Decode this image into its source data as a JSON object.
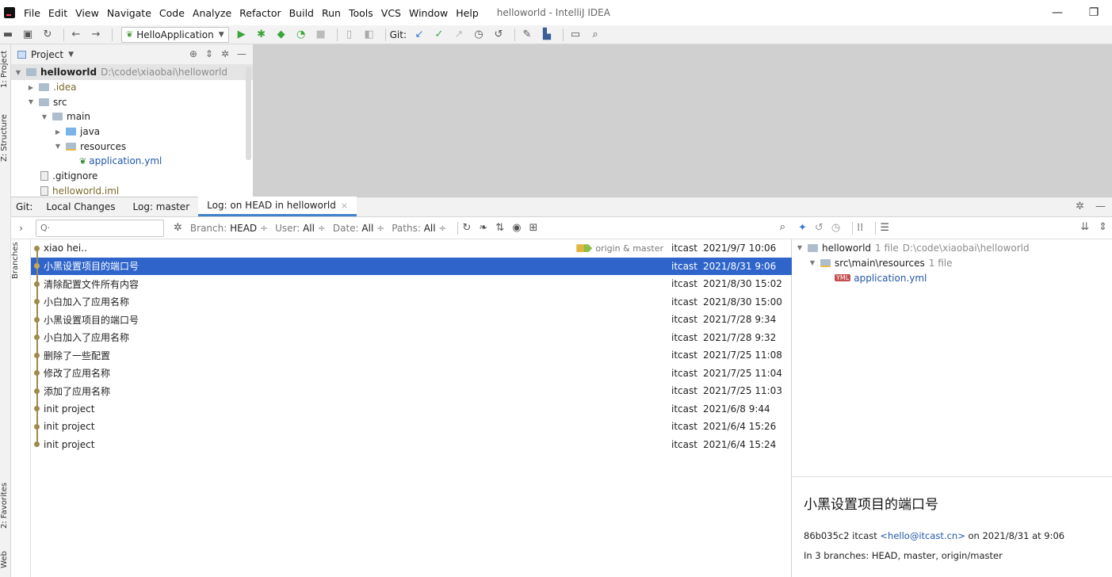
{
  "menubar": {
    "items": [
      "File",
      "Edit",
      "View",
      "Navigate",
      "Code",
      "Analyze",
      "Refactor",
      "Build",
      "Run",
      "Tools",
      "VCS",
      "Window",
      "Help"
    ],
    "window_title": "helloworld - IntelliJ IDEA",
    "minimize_glyph": "—",
    "restore_glyph": "❐"
  },
  "toolbar": {
    "run_config": "HelloApplication",
    "git_label": "Git:"
  },
  "left_strip": {
    "project_tab": "1: Project",
    "structure_tab": "Z: Structure",
    "favorites_tab": "2: Favorites",
    "web_tab": "Web"
  },
  "project_panel": {
    "title": "Project",
    "root_name": "helloworld",
    "root_path": "D:\\code\\xiaobai\\helloworld",
    "items": [
      ".idea",
      "src",
      "main",
      "java",
      "resources",
      "application.yml",
      ".gitignore",
      "helloworld.iml"
    ]
  },
  "git_tabs": {
    "prefix": "Git:",
    "tabs": [
      "Local Changes",
      "Log: master",
      "Log: on HEAD in helloworld"
    ],
    "close_glyph": "×"
  },
  "log_toolbar": {
    "search_placeholder": "Q·",
    "branch_label": "Branch:",
    "branch_value": "HEAD",
    "user_label": "User:",
    "user_value": "All",
    "date_label": "Date:",
    "date_value": "All",
    "paths_label": "Paths:",
    "paths_value": "All",
    "sort_glyph": "÷"
  },
  "branches_strip": "Branches",
  "commits": [
    {
      "message": "xiao hei..",
      "author": "itcast",
      "date": "2021/9/7 10:06",
      "ref": "origin & master"
    },
    {
      "message": "小黑设置项目的端口号",
      "author": "itcast",
      "date": "2021/8/31 9:06",
      "ref": ""
    },
    {
      "message": "清除配置文件所有内容",
      "author": "itcast",
      "date": "2021/8/30 15:02",
      "ref": ""
    },
    {
      "message": "小白加入了应用名称",
      "author": "itcast",
      "date": "2021/8/30 15:00",
      "ref": ""
    },
    {
      "message": "小黑设置项目的端口号",
      "author": "itcast",
      "date": "2021/7/28 9:34",
      "ref": ""
    },
    {
      "message": "小白加入了应用名称",
      "author": "itcast",
      "date": "2021/7/28 9:32",
      "ref": ""
    },
    {
      "message": "删除了一些配置",
      "author": "itcast",
      "date": "2021/7/25 11:08",
      "ref": ""
    },
    {
      "message": "修改了应用名称",
      "author": "itcast",
      "date": "2021/7/25 11:04",
      "ref": ""
    },
    {
      "message": "添加了应用名称",
      "author": "itcast",
      "date": "2021/7/25 11:03",
      "ref": ""
    },
    {
      "message": "init project",
      "author": "itcast",
      "date": "2021/6/8 9:44",
      "ref": ""
    },
    {
      "message": "init project",
      "author": "itcast",
      "date": "2021/6/4 15:26",
      "ref": ""
    },
    {
      "message": "init project",
      "author": "itcast",
      "date": "2021/6/4 15:24",
      "ref": ""
    }
  ],
  "selected_commit_index": 1,
  "changes": {
    "root": "helloworld",
    "root_count": "1 file",
    "root_path": "D:\\code\\xiaobai\\helloworld",
    "dir": "src\\main\\resources",
    "dir_count": "1 file",
    "file": "application.yml",
    "file_badge": "YML"
  },
  "commit_detail": {
    "title": "小黑设置项目的端口号",
    "hash_author": "86b035c2 itcast",
    "email": "<hello@itcast.cn>",
    "date_text": "on 2021/8/31 at 9:06",
    "branches": "In 3 branches: HEAD, master, origin/master"
  },
  "colors": {
    "selection": "#2f65ca",
    "graph": "#a08a4c",
    "accent_tab": "#4083c9",
    "link": "#2257a8"
  }
}
